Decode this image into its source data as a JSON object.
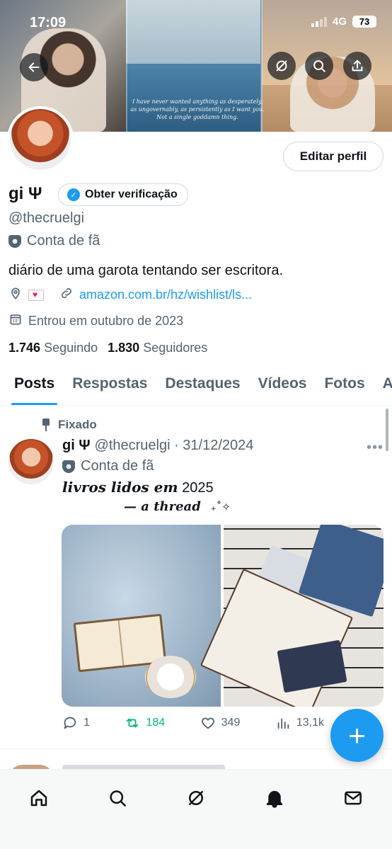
{
  "status_bar": {
    "time": "17:09",
    "network": "4G",
    "battery": "73"
  },
  "banner": {
    "quote": "I have never wanted anything as desperately, as ungovernably, as persistently as I want you. Not a single goddamn thing."
  },
  "profile": {
    "display_name": "gi Ψ",
    "verify_label": "Obter verificação",
    "edit_label": "Editar perfil",
    "handle": "@thecruelgi",
    "category": "Conta de fã",
    "bio": "diário de uma garota tentando ser escritora.",
    "link": "amazon.com.br/hz/wishlist/ls...",
    "joined": "Entrou em outubro de 2023",
    "following_count": "1.746",
    "following_label": "Seguindo",
    "followers_count": "1.830",
    "followers_label": "Seguidores"
  },
  "tabs": [
    "Posts",
    "Respostas",
    "Destaques",
    "Vídeos",
    "Fotos",
    "A"
  ],
  "post": {
    "pinned_label": "Fixado",
    "name": "gi Ψ",
    "meta": "@thecruelgi · 31/12/2024",
    "category": "Conta de fã",
    "text_italic": "livros lidos em",
    "text_year": "2025",
    "text_line2": "— a thread",
    "sparkle": "₊˚✧",
    "replies": "1",
    "reposts": "184",
    "likes": "349",
    "views": "13,1k"
  },
  "fab_label": "+",
  "colors": {
    "accent": "#1d9bf0",
    "repost": "#00ba7c",
    "secondary_text": "#536471"
  },
  "icons": {
    "back": "arrow-left-icon",
    "grok": "grok-icon",
    "search": "search-icon",
    "share": "share-icon",
    "home": "home-icon",
    "notifications": "bell-icon",
    "messages": "envelope-icon"
  }
}
